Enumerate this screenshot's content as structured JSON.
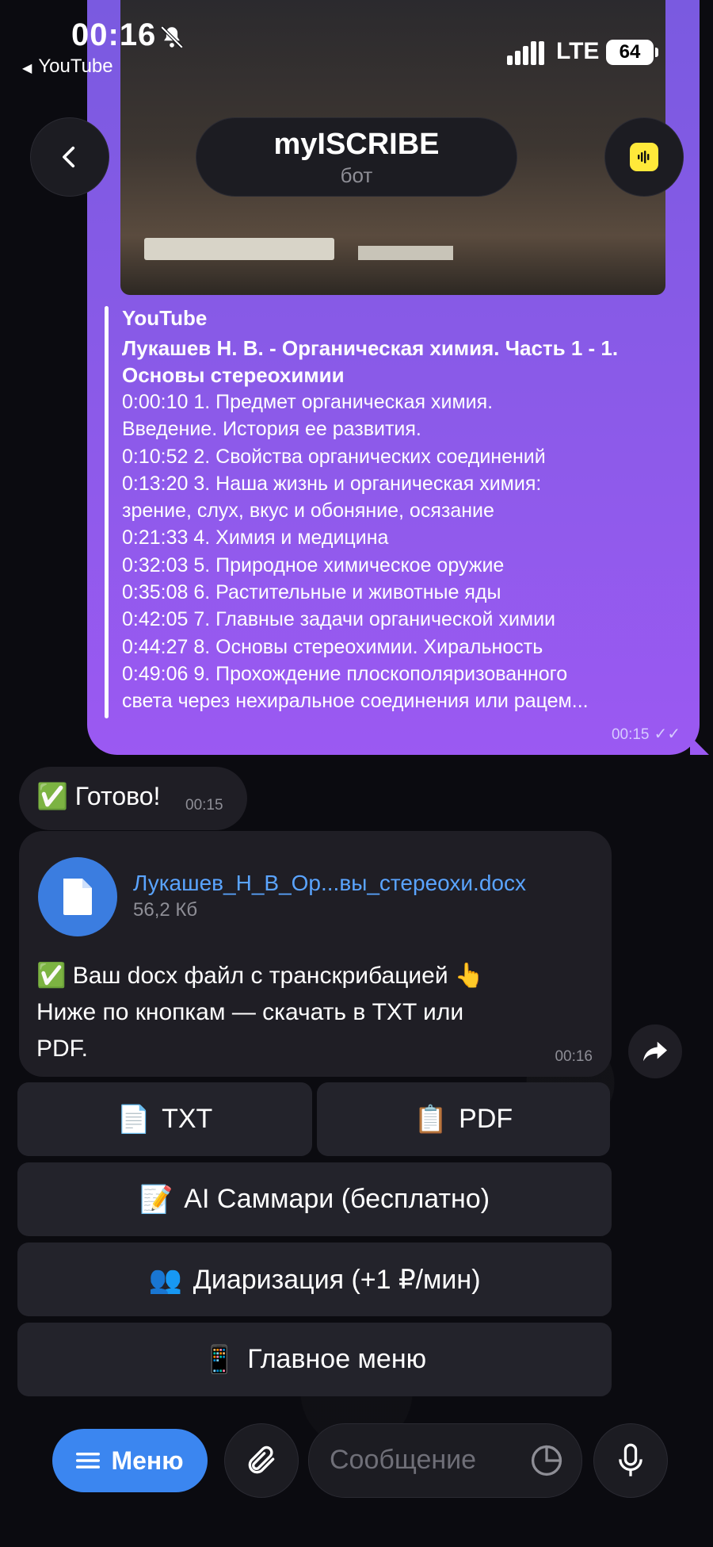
{
  "status_bar": {
    "time": "00:16",
    "back_app": "YouTube",
    "network": "LTE",
    "battery": "64"
  },
  "header": {
    "title": "myISCRIBE",
    "subtitle": "бот"
  },
  "link_preview": {
    "site": "YouTube",
    "title": "Лукашев Н. В. - Органическая химия. Часть 1 - 1. Основы стереохимии",
    "description": "0:00:10 1. Предмет органическая химия.\nВведение. История ее развития.\n0:10:52 2. Свойства органических соединений\n0:13:20 3. Наша жизнь и органическая химия:\nзрение, слух, вкус и обоняние, осязание\n0:21:33 4. Химия и медицина\n0:32:03 5. Природное химическое оружие\n0:35:08 6. Растительные и животные яды\n0:42:05 7. Главные задачи органической химии\n0:44:27 8. Основы стереохимии. Хиральность\n0:49:06 9. Прохождение плоскополяризованного\nсвета через нехиральное соединения или рацем...",
    "time": "00:15"
  },
  "ready_message": {
    "text": "✅ Готово!",
    "time": "00:15"
  },
  "file_message": {
    "file_name": "Лукашев_Н_В_Ор...вы_стереохи.docx",
    "file_size": "56,2 Кб",
    "text": "✅ Ваш docx файл с транскрибацией 👆\nНиже по кнопкам — скачать в TXT или\nPDF.",
    "time": "00:16"
  },
  "keyboard": {
    "txt": {
      "emoji": "📄",
      "label": "TXT"
    },
    "pdf": {
      "emoji": "📋",
      "label": "PDF"
    },
    "summary": {
      "emoji": "📝",
      "label": "AI Саммари (бесплатно)"
    },
    "diarization": {
      "emoji": "👥",
      "label": "Диаризация (+1 ₽/мин)"
    },
    "main_menu": {
      "emoji": "📱",
      "label": "Главное меню"
    }
  },
  "input_bar": {
    "menu_label": "Меню",
    "placeholder": "Сообщение"
  },
  "colors": {
    "accent_blue": "#3b86f0",
    "outgoing_bubble": "#8a5ae8",
    "link_blue": "#5aa4ff"
  }
}
